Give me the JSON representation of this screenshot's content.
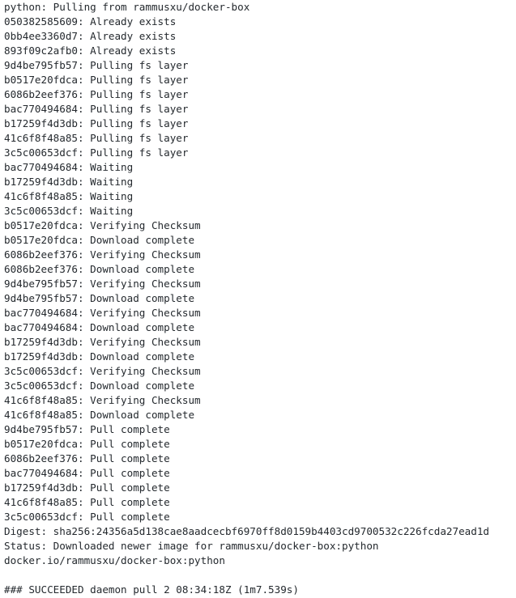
{
  "log": {
    "lines": [
      "python: Pulling from rammusxu/docker-box",
      "050382585609: Already exists",
      "0bb4ee3360d7: Already exists",
      "893f09c2afb0: Already exists",
      "9d4be795fb57: Pulling fs layer",
      "b0517e20fdca: Pulling fs layer",
      "6086b2eef376: Pulling fs layer",
      "bac770494684: Pulling fs layer",
      "b17259f4d3db: Pulling fs layer",
      "41c6f8f48a85: Pulling fs layer",
      "3c5c00653dcf: Pulling fs layer",
      "bac770494684: Waiting",
      "b17259f4d3db: Waiting",
      "41c6f8f48a85: Waiting",
      "3c5c00653dcf: Waiting",
      "b0517e20fdca: Verifying Checksum",
      "b0517e20fdca: Download complete",
      "6086b2eef376: Verifying Checksum",
      "6086b2eef376: Download complete",
      "9d4be795fb57: Verifying Checksum",
      "9d4be795fb57: Download complete",
      "bac770494684: Verifying Checksum",
      "bac770494684: Download complete",
      "b17259f4d3db: Verifying Checksum",
      "b17259f4d3db: Download complete",
      "3c5c00653dcf: Verifying Checksum",
      "3c5c00653dcf: Download complete",
      "41c6f8f48a85: Verifying Checksum",
      "41c6f8f48a85: Download complete",
      "9d4be795fb57: Pull complete",
      "b0517e20fdca: Pull complete",
      "6086b2eef376: Pull complete",
      "bac770494684: Pull complete",
      "b17259f4d3db: Pull complete",
      "41c6f8f48a85: Pull complete",
      "3c5c00653dcf: Pull complete",
      "Digest: sha256:24356a5d138cae8aadcecbf6970ff8d0159b4403cd9700532c226fcda27ead1d",
      "Status: Downloaded newer image for rammusxu/docker-box:python",
      "docker.io/rammusxu/docker-box:python"
    ],
    "summary": "### SUCCEEDED daemon pull 2 08:34:18Z (1m7.539s)"
  }
}
